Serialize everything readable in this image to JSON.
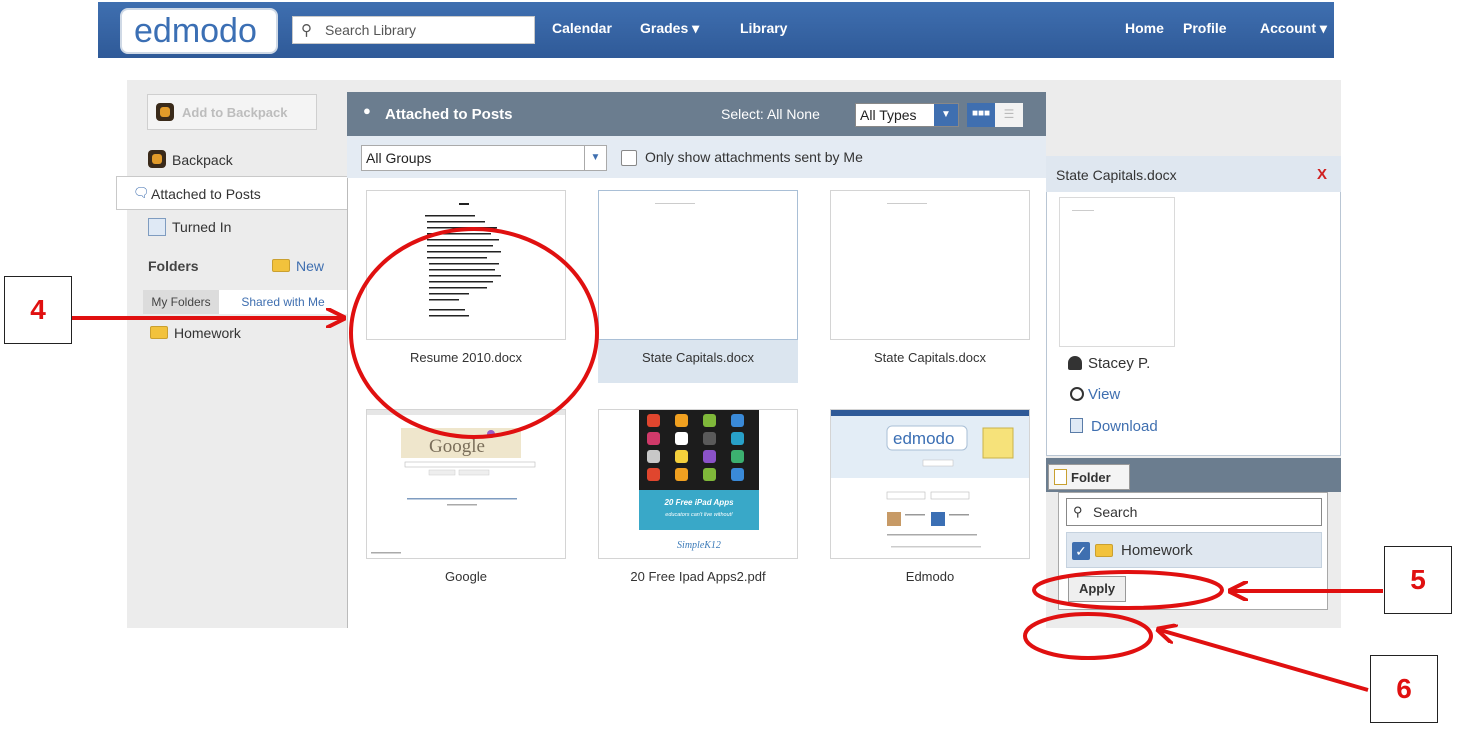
{
  "header": {
    "logo_text": "edmodo",
    "search_placeholder": "Search Library",
    "nav_left": [
      "Calendar",
      "Grades ▾",
      "Library"
    ],
    "nav_right": [
      "Home",
      "Profile",
      "Account ▾"
    ]
  },
  "sidebar": {
    "add_backpack_label": "Add to Backpack",
    "backpack_label": "Backpack",
    "attached_label": "Attached to Posts",
    "turned_in_label": "Turned In",
    "folders_heading": "Folders",
    "new_folder_label": "New",
    "tabs": [
      "My Folders",
      "Shared with Me"
    ],
    "folders": [
      "Homework"
    ]
  },
  "content": {
    "title": "Attached to Posts",
    "select_label": "Select:",
    "select_all": "All",
    "select_none": "None",
    "type_filter": "All Types",
    "group_filter": "All Groups",
    "only_me_label": "Only show attachments sent by Me",
    "files": [
      {
        "name": "Resume 2010.docx",
        "selected": false
      },
      {
        "name": "State Capitals.docx",
        "selected": true
      },
      {
        "name": "State Capitals.docx",
        "selected": false
      },
      {
        "name": "Google",
        "selected": false
      },
      {
        "name": "20 Free Ipad Apps2.pdf",
        "selected": false
      },
      {
        "name": "Edmodo",
        "selected": false
      }
    ],
    "thumb_text": {
      "google_logo": "Google",
      "ipad_line1": "20 Free iPad Apps",
      "ipad_line2": "educators can't live without!",
      "ipad_brand": "SimpleK12",
      "edmodo_logo": "edmodo"
    }
  },
  "detail": {
    "title": "State Capitals.docx",
    "close": "X",
    "owner": "Stacey P.",
    "view_label": "View",
    "download_label": "Download",
    "folder_button": "Folder",
    "folder_search": "Search",
    "folder_option": "Homework",
    "folder_option_checked": true,
    "apply_label": "Apply"
  },
  "annotations": {
    "callouts": [
      "4",
      "5",
      "6"
    ],
    "color": "#e01010"
  }
}
